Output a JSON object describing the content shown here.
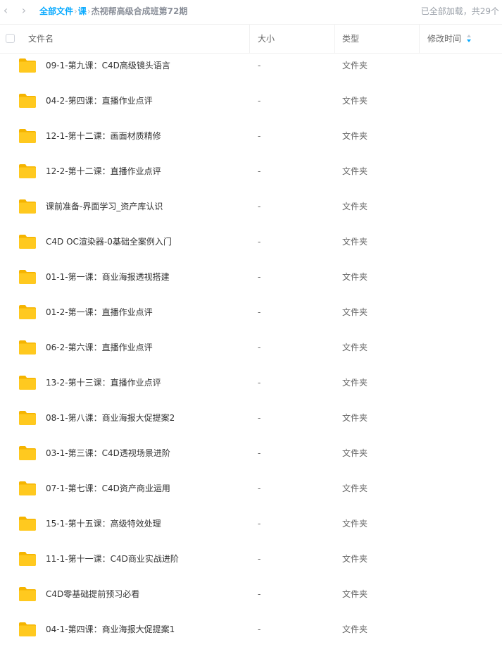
{
  "breadcrumb": {
    "root": "全部文件",
    "parent": "课",
    "current": "杰视帮高级合成班第72期",
    "separator": "›"
  },
  "status": {
    "loaded_text": "已全部加载，共29个"
  },
  "header": {
    "name": "文件名",
    "size": "大小",
    "type": "类型",
    "modified": "修改时间"
  },
  "icons": {
    "folder": "folder-icon",
    "back": "chevron-left-icon",
    "forward": "chevron-right-icon",
    "sort": "sort-icon"
  },
  "colors": {
    "accent": "#09aaff",
    "folder": "#ffc91f"
  },
  "files": [
    {
      "name": "09-1-第九课：C4D高级镜头语言",
      "size": "-",
      "type": "文件夹"
    },
    {
      "name": "04-2-第四课：直播作业点评",
      "size": "-",
      "type": "文件夹"
    },
    {
      "name": "12-1-第十二课：画面材质精修",
      "size": "-",
      "type": "文件夹"
    },
    {
      "name": "12-2-第十二课：直播作业点评",
      "size": "-",
      "type": "文件夹"
    },
    {
      "name": "课前准备-界面学习_资产库认识",
      "size": "-",
      "type": "文件夹"
    },
    {
      "name": "C4D OC渲染器-0基础全案例入门",
      "size": "-",
      "type": "文件夹"
    },
    {
      "name": "01-1-第一课：商业海报透视搭建",
      "size": "-",
      "type": "文件夹"
    },
    {
      "name": "01-2-第一课：直播作业点评",
      "size": "-",
      "type": "文件夹"
    },
    {
      "name": "06-2-第六课：直播作业点评",
      "size": "-",
      "type": "文件夹"
    },
    {
      "name": "13-2-第十三课：直播作业点评",
      "size": "-",
      "type": "文件夹"
    },
    {
      "name": "08-1-第八课：商业海报大促提案2",
      "size": "-",
      "type": "文件夹"
    },
    {
      "name": "03-1-第三课：C4D透视场景进阶",
      "size": "-",
      "type": "文件夹"
    },
    {
      "name": "07-1-第七课：C4D资产商业运用",
      "size": "-",
      "type": "文件夹"
    },
    {
      "name": "15-1-第十五课：高级特效处理",
      "size": "-",
      "type": "文件夹"
    },
    {
      "name": "11-1-第十一课：C4D商业实战进阶",
      "size": "-",
      "type": "文件夹"
    },
    {
      "name": "C4D零基础提前预习必看",
      "size": "-",
      "type": "文件夹"
    },
    {
      "name": "04-1-第四课：商业海报大促提案1",
      "size": "-",
      "type": "文件夹"
    }
  ]
}
